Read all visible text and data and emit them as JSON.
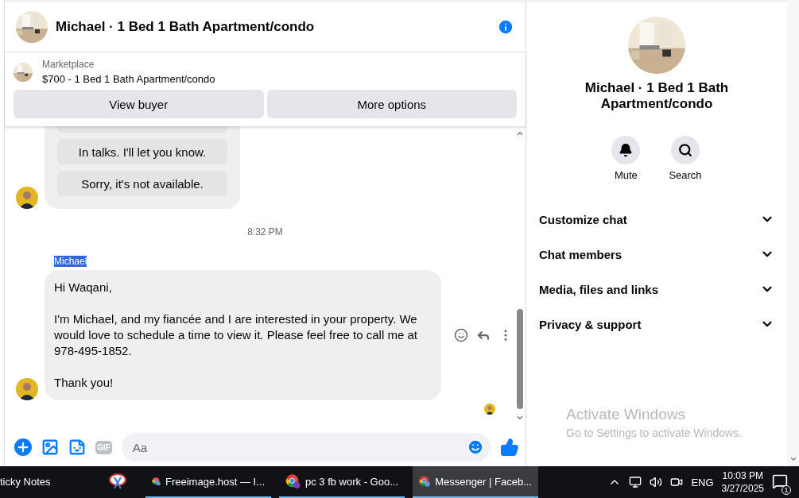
{
  "header": {
    "title": "Michael · 1 Bed 1 Bath Apartment/condo"
  },
  "listing": {
    "label": "Marketplace",
    "title": "$700 - 1 Bed 1 Bath Apartment/condo",
    "buttons": [
      "View buyer",
      "More options"
    ]
  },
  "messages": [
    {
      "kind": "options",
      "options": [
        "In talks. I'll let you know.",
        "Sorry, it's not available."
      ]
    },
    {
      "kind": "time",
      "text": "8:32 PM"
    },
    {
      "kind": "sender",
      "text": "Michael",
      "selected": true
    },
    {
      "kind": "text",
      "paragraphs": [
        "Hi Waqani,",
        "I'm Michael, and my fiancée and I are interested in your property. We would love to schedule a time to view it. Please feel free to call me at 978-495-1852.",
        "Thank you!"
      ]
    }
  ],
  "composer": {
    "placeholder": "Aa",
    "gif": "GIF"
  },
  "panel": {
    "title": "Michael · 1 Bed 1 Bath Apartment/condo",
    "actions": [
      {
        "kind": "mute",
        "label": "Mute"
      },
      {
        "kind": "search",
        "label": "Search"
      }
    ],
    "sections": [
      {
        "label": "Customize chat",
        "expanded": false
      },
      {
        "label": "Chat members",
        "expanded": false
      },
      {
        "label": "Media, files and links",
        "expanded": false
      },
      {
        "label": "Privacy & support",
        "expanded": false
      }
    ]
  },
  "activation": {
    "title": "Activate Windows",
    "subtitle": "Go to Settings to activate Windows."
  },
  "taskbar": {
    "apps": [
      {
        "kind": "notes",
        "label": "ticky Notes",
        "selected": false
      },
      {
        "kind": "snip",
        "selected": false
      },
      {
        "kind": "chrome",
        "label": "Freeimage.host — I...",
        "selected": false
      },
      {
        "kind": "chrome-p",
        "label": "pc 3 fb work - Goo...",
        "selected": false
      },
      {
        "kind": "chrome",
        "label": "Messenger | Faceb...",
        "selected": true
      }
    ],
    "language": "ENG",
    "time": "10:03 PM",
    "date": "3/27/2025",
    "notifications": "1"
  }
}
